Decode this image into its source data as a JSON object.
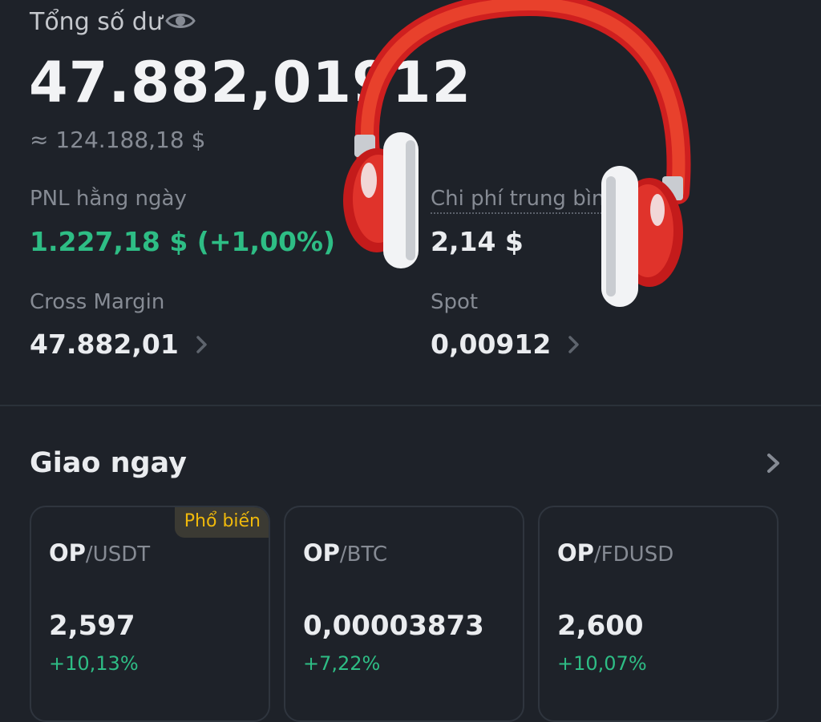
{
  "balance": {
    "label": "Tổng số dư",
    "value": "47.882,01912",
    "usd_equiv": "≈ 124.188,18 $"
  },
  "stats": {
    "pnl_label": "PNL hằng ngày",
    "pnl_value": "1.227,18 $ (+1,00%)",
    "avg_cost_label": "Chi phí trung bình",
    "avg_cost_value": "2,14 $",
    "cross_margin_label": "Cross Margin",
    "cross_margin_value": "47.882,01",
    "spot_label": "Spot",
    "spot_value": "0,00912"
  },
  "section": {
    "title": "Giao ngay"
  },
  "markets": [
    {
      "base": "OP",
      "quote": "/USDT",
      "price": "2,597",
      "change": "+10,13%",
      "badge": "Phổ biến"
    },
    {
      "base": "OP",
      "quote": "/BTC",
      "price": "0,00003873",
      "change": "+7,22%"
    },
    {
      "base": "OP",
      "quote": "/FDUSD",
      "price": "2,600",
      "change": "+10,07%"
    }
  ],
  "icons": {
    "eye": "eye-icon",
    "chevron": "chevron-right-icon",
    "sticker": "headphones-icon"
  },
  "colors": {
    "background": "#1e2229",
    "positive": "#2ebd85",
    "badge_text": "#f0b90b",
    "muted": "#868b94"
  }
}
